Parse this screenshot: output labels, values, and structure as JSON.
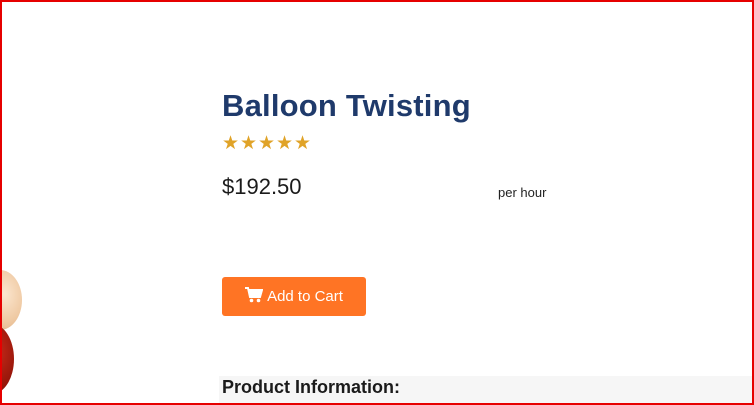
{
  "product": {
    "title": "Balloon Twisting",
    "rating": 5,
    "rating_max": 5,
    "price": "$192.50",
    "price_unit": "per hour",
    "add_to_cart_label": "Add to Cart",
    "info_heading": "Product Information:"
  },
  "colors": {
    "title": "#1f3a6b",
    "star": "#e0a328",
    "button": "#ff7424",
    "frame": "#e60000"
  },
  "icons": {
    "cart": "shopping-cart-icon",
    "star": "star-icon"
  }
}
